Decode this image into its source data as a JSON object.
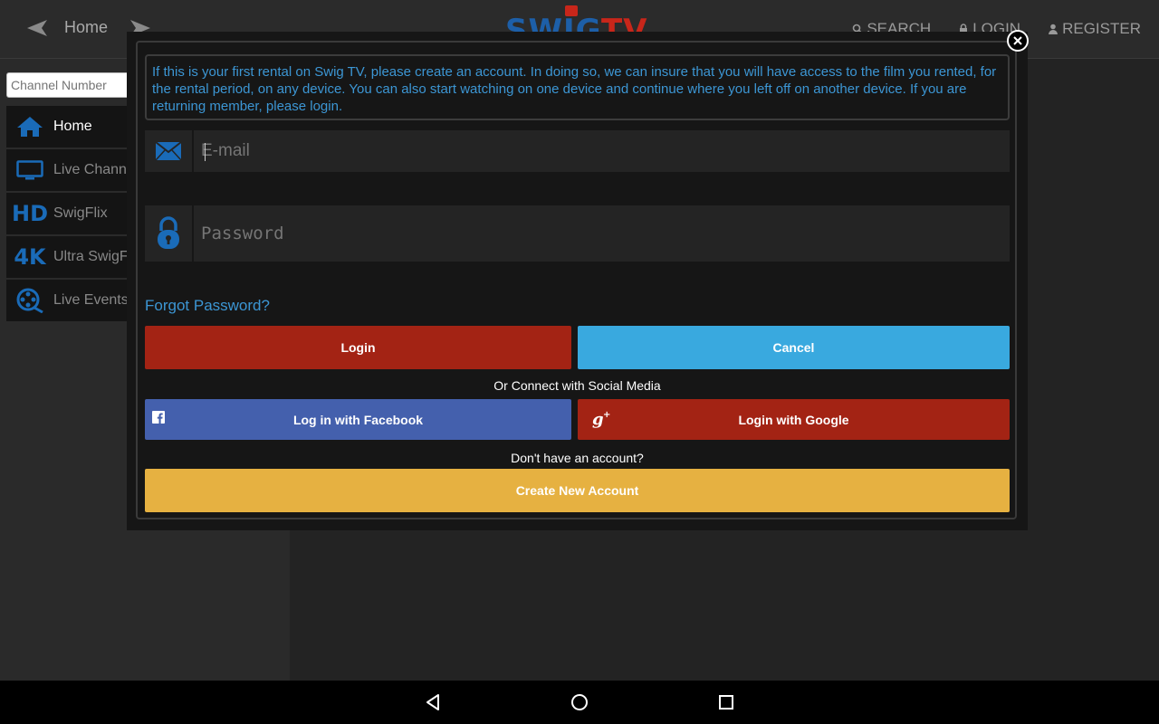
{
  "topbar": {
    "title": "Home",
    "logo": {
      "part1": "SWIG",
      "part2": "TV"
    },
    "links": [
      {
        "label": "SEARCH",
        "icon": "search-icon"
      },
      {
        "label": "LOGIN",
        "icon": "lock-icon"
      },
      {
        "label": "REGISTER",
        "icon": "user-icon"
      }
    ]
  },
  "sidebar": {
    "channel_placeholder": "Channel Number",
    "items": [
      {
        "label": "Home",
        "icon": "home-icon",
        "active": true
      },
      {
        "label": "Live Channe",
        "icon": "tv-icon"
      },
      {
        "label": "SwigFlix",
        "icon": "hd-icon",
        "glyph": "HD"
      },
      {
        "label": "Ultra SwigF",
        "icon": "4k-icon",
        "glyph": "4K"
      },
      {
        "label": "Live Events",
        "icon": "film-reel-icon"
      }
    ]
  },
  "modal": {
    "info": "If this is your first rental on Swig TV, please create an account. In doing so, we can insure that you will have access to the film you rented, for the rental period, on any device. You can also start watching on one device and continue where you left off on another device. If you are returning member, please login.",
    "email_placeholder": "E-mail",
    "password_placeholder": "Password",
    "forgot": "Forgot Password?",
    "login_label": "Login",
    "cancel_label": "Cancel",
    "social_label": "Or Connect with Social Media",
    "facebook_label": "Log in with Facebook",
    "google_label": "Login with Google",
    "no_account": "Don't have an account?",
    "create_label": "Create New Account"
  },
  "colors": {
    "accent_blue": "#3c96d4",
    "login_red": "#a32314",
    "cancel_blue": "#39a9df",
    "facebook_blue": "#4460ad",
    "create_yellow": "#e6b141"
  }
}
